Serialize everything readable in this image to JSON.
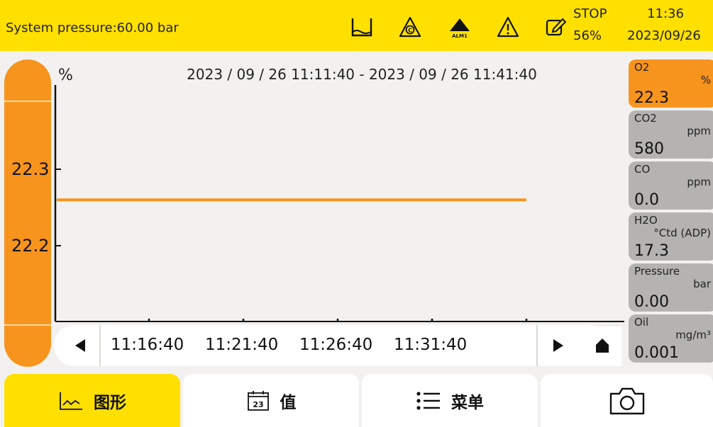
{
  "header": {
    "system_pressure": "System pressure:60.00 bar",
    "alarm_label": "ALM1",
    "stop_label": "STOP",
    "stop_percent": "56%",
    "time": "11:36",
    "date": "2023/09/26",
    "icons": [
      "container-level-icon",
      "calibration-icon",
      "alarm-icon",
      "warning-icon",
      "edit-icon"
    ]
  },
  "chart": {
    "unit": "%",
    "time_range": "2023 / 09 / 26 11:11:40 - 2023 / 09 / 26 11:41:40",
    "y_tick_labels": [
      "22.3",
      "22.2"
    ],
    "x_tick_labels": [
      "11:16:40",
      "11:21:40",
      "11:26:40",
      "11:31:40"
    ]
  },
  "chart_data": {
    "type": "line",
    "ylabel": "%",
    "title": "2023 / 09 / 26 11:11:40 - 2023 / 09 / 26 11:41:40",
    "x_ticks": [
      "11:16:40",
      "11:21:40",
      "11:26:40",
      "11:31:40"
    ],
    "y_ticks": [
      22.3,
      22.2
    ],
    "series": [
      {
        "x": [
          "11:11:40",
          "11:36:40"
        ],
        "values": [
          22.26,
          22.26
        ]
      }
    ],
    "colors": {
      "line": "#f7941d"
    }
  },
  "panels": [
    {
      "name": "O2",
      "unit": "%",
      "value": "22.3",
      "active": true
    },
    {
      "name": "CO2",
      "unit": "ppm",
      "value": "580",
      "active": false
    },
    {
      "name": "CO",
      "unit": "ppm",
      "value": "0.0",
      "active": false
    },
    {
      "name": "H2O",
      "unit": "°Ctd (ADP)",
      "value": "17.3",
      "active": false
    },
    {
      "name": "Pressure",
      "unit": "bar",
      "value": "0.00",
      "active": false
    },
    {
      "name": "Oil",
      "unit": "mg/m³",
      "value": "0.001",
      "active": false
    }
  ],
  "tabs": [
    {
      "label": "图形",
      "icon": "line-chart-icon",
      "active": true
    },
    {
      "label": "值",
      "icon": "calendar-icon",
      "active": false
    },
    {
      "label": "菜单",
      "icon": "menu-list-icon",
      "active": false
    },
    {
      "label": "",
      "icon": "camera-icon",
      "active": false
    }
  ],
  "colors": {
    "header_bg": "#ffe000",
    "accent_orange": "#f7941d",
    "panel_gray": "#b4b3b2"
  }
}
